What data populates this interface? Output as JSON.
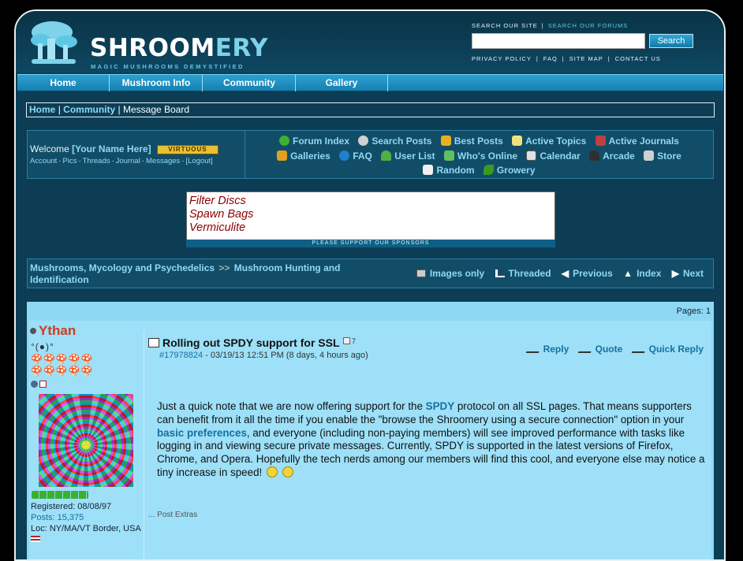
{
  "site": {
    "logo_word_a": "SHROOM",
    "logo_word_b": "ERY",
    "tagline": "MAGIC MUSHROOMS DEMYSTIFIED",
    "search_site": "SEARCH OUR SITE",
    "search_forums": "SEARCH OUR FORUMS",
    "search_value": "",
    "search_button": "Search",
    "top_links": [
      "PRIVACY POLICY",
      "FAQ",
      "SITE MAP",
      "CONTACT US"
    ]
  },
  "nav": {
    "tabs": [
      "Home",
      "Mushroom Info",
      "Community",
      "Gallery"
    ]
  },
  "breadcrumb": {
    "home": "Home",
    "community": "Community",
    "current": "Message Board",
    "sep": "|"
  },
  "welcome": {
    "prefix": "Welcome",
    "name": "[Your Name Here]",
    "badge": "VIRTUOUS",
    "links": [
      "Account",
      "Pics",
      "Threads",
      "Journal",
      "Messages",
      "[Logout]"
    ]
  },
  "forum_links": [
    {
      "label": "Forum Index",
      "icon": "arrow-up-icon",
      "color": "#3cb030"
    },
    {
      "label": "Search Posts",
      "icon": "magnifier-icon",
      "color": "#d0d0d0"
    },
    {
      "label": "Best Posts",
      "icon": "medal-icon",
      "color": "#e8b020"
    },
    {
      "label": "Active Topics",
      "icon": "pages-icon",
      "color": "#f0e080"
    },
    {
      "label": "Active Journals",
      "icon": "journal-icon",
      "color": "#c04040"
    },
    {
      "label": "Galleries",
      "icon": "gallery-icon",
      "color": "#e0a020"
    },
    {
      "label": "FAQ",
      "icon": "help-icon",
      "color": "#2080d0"
    },
    {
      "label": "User List",
      "icon": "user-icon",
      "color": "#50b040"
    },
    {
      "label": "Who's Online",
      "icon": "online-icon",
      "color": "#60c060"
    },
    {
      "label": "Calendar",
      "icon": "calendar-icon",
      "color": "#e0e0e0"
    },
    {
      "label": "Arcade",
      "icon": "joystick-icon",
      "color": "#303030"
    },
    {
      "label": "Store",
      "icon": "cart-icon",
      "color": "#d0d0d0"
    },
    {
      "label": "Random",
      "icon": "dice-icon",
      "color": "#f0f0f0"
    },
    {
      "label": "Growery",
      "icon": "leaf-icon",
      "color": "#3a9a20"
    }
  ],
  "sponsor": {
    "items": [
      "Filter Discs",
      "Spawn Bags",
      "Vermiculite"
    ],
    "bar": "PLEASE SUPPORT OUR SPONSORS"
  },
  "thread_bar": {
    "crumb_a": "Mushrooms, Mycology and Psychedelics",
    "arrow": ">>",
    "crumb_b": "Mushroom Hunting and Identification",
    "tools": [
      "Images only",
      "Threaded",
      "Previous",
      "Index",
      "Next"
    ]
  },
  "post": {
    "pages": "Pages: 1",
    "username": "Ythan",
    "user_face": "°(●)°",
    "mushrooms_row1": "🍄🍄🍄🍄🍄",
    "mushrooms_row2": "🍄🍄🍄🍄🍄",
    "registered": "Registered: 08/08/97",
    "posts": "Posts: 15,375",
    "loc": "Loc: NY/MA/VT Border, USA",
    "title": "Rolling out SPDY support for SSL",
    "title_count": "7",
    "post_id": "#17978824",
    "post_time": " - 03/19/13 12:51 PM (8 days, 4 hours ago)",
    "actions": [
      "Reply",
      "Quote",
      "Quick Reply"
    ],
    "body_1": "Just a quick note that we are now offering support for the ",
    "body_spdy": "SPDY",
    "body_2": " protocol on all SSL pages. That means supporters can benefit from it all the time if you enable the \"browse the Shroomery using a secure connection\" option in your ",
    "body_prefs": "basic preferences",
    "body_3": ", and everyone (including non-paying members) will see improved performance with tasks like logging in and viewing secure private messages. Currently, SPDY is supported in the latest versions of Firefox, Chrome, and Opera. Hopefully the tech nerds among our members will find this cool, and everyone else may notice a tiny increase in speed!",
    "extras": "... Post Extras"
  }
}
